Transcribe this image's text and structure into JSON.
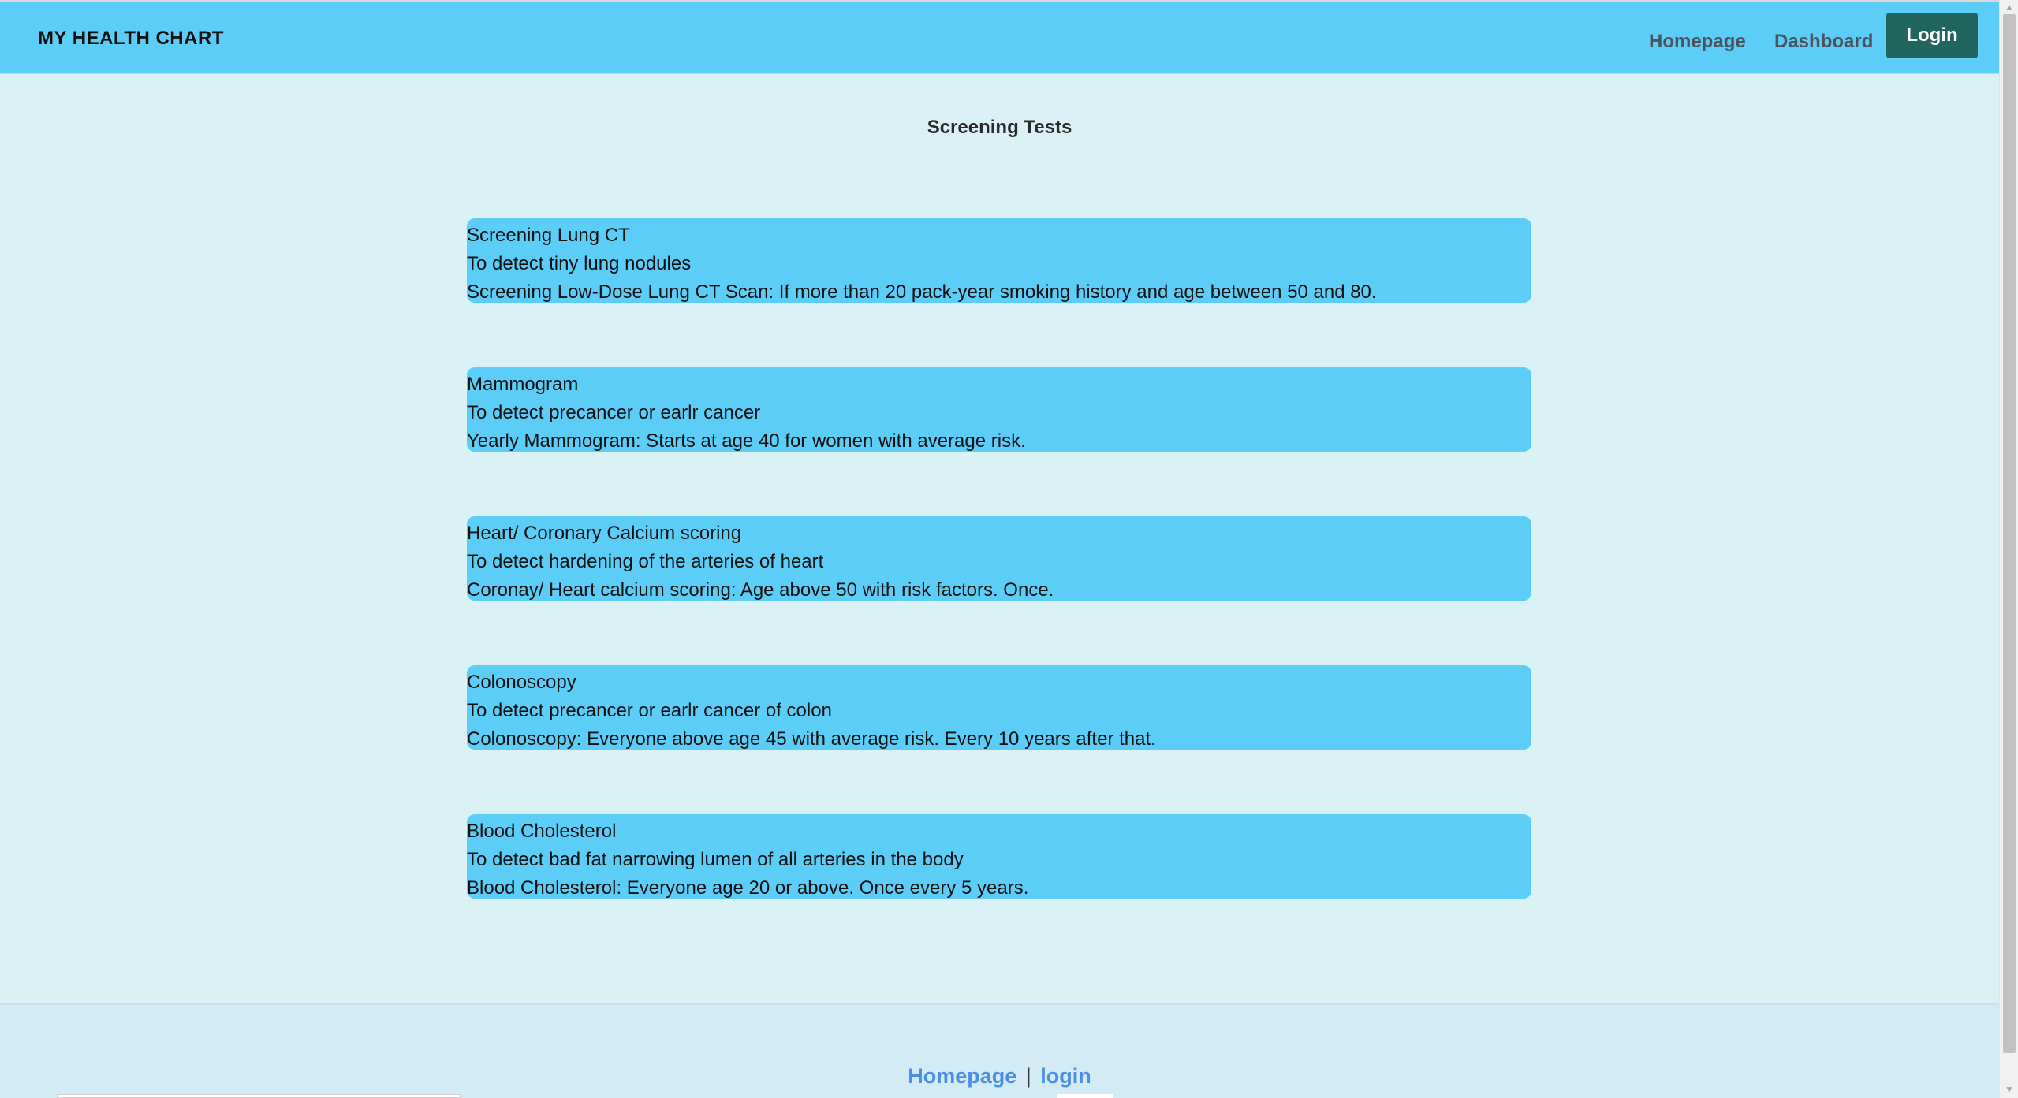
{
  "navbar": {
    "brand": "MY HEALTH CHART",
    "links": [
      "Homepage",
      "Dashboard"
    ],
    "login_label": "Login"
  },
  "main": {
    "title": "Screening Tests",
    "cards": [
      {
        "name": "Screening Lung CT",
        "purpose": "To detect tiny lung nodules",
        "detail": "Screening Low-Dose Lung CT Scan: If more than 20 pack-year smoking history and age between 50 and 80."
      },
      {
        "name": "Mammogram",
        "purpose": "To detect precancer or earlr cancer",
        "detail": "Yearly Mammogram: Starts at age 40 for women with average risk."
      },
      {
        "name": "Heart/ Coronary Calcium scoring",
        "purpose": "To detect hardening of the arteries of heart",
        "detail": "Coronay/ Heart calcium scoring: Age above 50 with risk factors. Once."
      },
      {
        "name": "Colonoscopy",
        "purpose": "To detect precancer or earlr cancer of colon",
        "detail": "Colonoscopy: Everyone above age 45 with average risk. Every 10 years after that."
      },
      {
        "name": "Blood Cholesterol",
        "purpose": "To detect bad fat narrowing lumen of all arteries in the body",
        "detail": "Blood Cholesterol: Everyone age 20 or above. Once every 5 years."
      }
    ]
  },
  "footer": {
    "home_link": "Homepage",
    "separator": "|",
    "login_link": "login"
  },
  "colors": {
    "navbar_bg": "#5bcdf7",
    "page_bg": "#daf2f5",
    "login_bg": "#20665e",
    "footer_link": "#4a8fe3"
  },
  "icons": {
    "scroll_up": "scroll-up-arrow-icon",
    "scroll_down": "scroll-down-arrow-icon"
  }
}
